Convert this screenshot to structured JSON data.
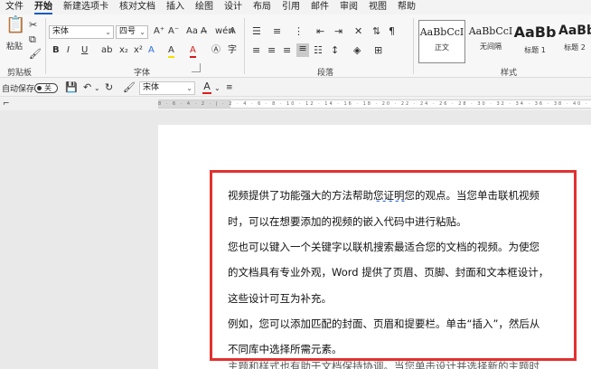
{
  "menu": {
    "tabs": [
      "文件",
      "开始",
      "新建选项卡",
      "核对文档",
      "插入",
      "绘图",
      "设计",
      "布局",
      "引用",
      "邮件",
      "审阅",
      "视图",
      "帮助"
    ],
    "active": "开始"
  },
  "ribbon": {
    "clipboard": {
      "paste_label": "粘贴",
      "group_label": "剪贴板"
    },
    "font": {
      "font_name": "宋体",
      "font_size": "四号",
      "group_label": "字体",
      "row1_icons": [
        "A⁺",
        "A⁻",
        "Aa",
        "A̶",
        "wén",
        "A"
      ],
      "row2_icons": [
        "B",
        "I",
        "U",
        "ab",
        "x₂",
        "x²",
        "A",
        "A",
        "A",
        "Ⓐ",
        "字"
      ]
    },
    "paragraph": {
      "group_label": "段落"
    },
    "styles": {
      "group_label": "样式",
      "items": [
        {
          "sample": "AaBbCcI",
          "name": "正文"
        },
        {
          "sample": "AaBbCcI",
          "name": "无间隔"
        },
        {
          "sample": "AaBb",
          "name": "标题 1"
        },
        {
          "sample": "AaBbC",
          "name": "标题 2"
        }
      ]
    }
  },
  "qat": {
    "autosave_label": "自动保存",
    "autosave_state": "关",
    "font_name": "宋体"
  },
  "document": {
    "paragraphs": [
      {
        "pre": "视频提供了功能强大的方法帮助",
        "underlined": "您证明",
        "post": "您的观点。当您单击联机视频"
      },
      {
        "pre": "时，可以在想要添加的视频的嵌入代码中进行粘贴。",
        "underlined": "",
        "post": ""
      },
      {
        "pre": "您也可以键入一个关键字以联机搜索最适合您的文档的视频。为使您",
        "underlined": "",
        "post": ""
      },
      {
        "pre": "的文档具有专业外观，Word 提供了页眉、页脚、封面和文本框设计，",
        "underlined": "",
        "post": ""
      },
      {
        "pre": "这些设计可互为补充。",
        "underlined": "",
        "post": ""
      },
      {
        "pre": "例如，您可以添加匹配的封面、页眉和提要栏。单击“插入”，然后从",
        "underlined": "",
        "post": ""
      },
      {
        "pre": "不同库中选择所需元素。",
        "underlined": "",
        "post": ""
      }
    ],
    "cut_line": "主题和样式也有助于文档保持协调。当您单击设计并选择新的主题时"
  },
  "colors": {
    "highlight_box": "#e2312f",
    "accent": "#185abd"
  }
}
